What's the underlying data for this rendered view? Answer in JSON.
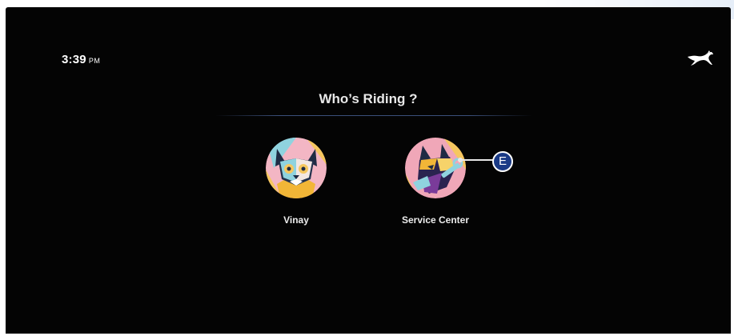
{
  "status_bar": {
    "time": "3:39",
    "ampm": "PM"
  },
  "brand": {
    "logo_icon": "horse-icon"
  },
  "screen": {
    "title": "Who’s Riding ?"
  },
  "profiles": [
    {
      "name": "Vinay",
      "avatar_icon": "cat-avatar-icon"
    },
    {
      "name": "Service Center",
      "avatar_icon": "fox-mechanic-avatar-icon"
    }
  ],
  "callout": {
    "label": "E"
  },
  "colors": {
    "background": "#040404",
    "callout_badge": "#1a3a86",
    "divider": "#3b4f7a"
  }
}
